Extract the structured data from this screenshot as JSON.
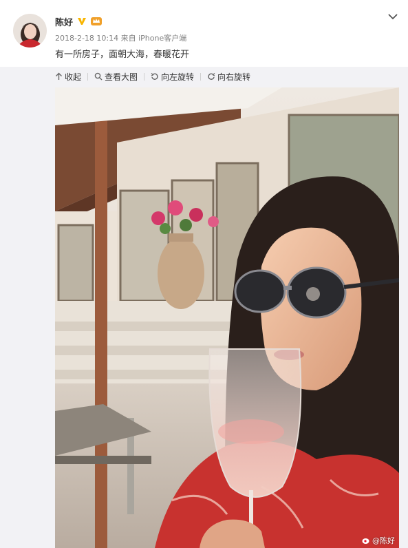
{
  "post": {
    "author": "陈好",
    "meta": "2018-2-18 10:14 来自 iPhone客户端",
    "content": "有一所房子，面朝大海，春暖花开"
  },
  "toolbar": {
    "collapse": "收起",
    "view_large": "查看大图",
    "rotate_left": "向左旋转",
    "rotate_right": "向右旋转"
  },
  "photo": {
    "watermark": "@陈好"
  },
  "icons": {
    "more": "chevron-down-icon",
    "verified": "verified-v-icon",
    "member": "member-crown-icon"
  },
  "colors": {
    "verified": "#f8b500",
    "member": "#f0a02a",
    "toolbar_bg": "#f2f2f5"
  }
}
